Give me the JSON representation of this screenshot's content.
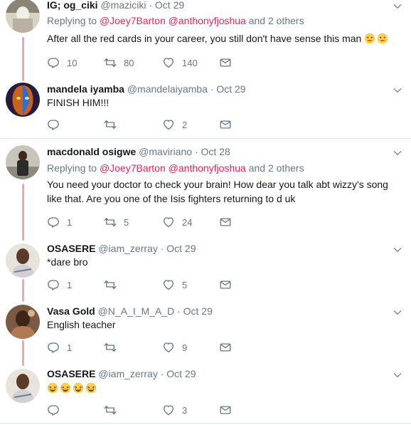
{
  "tweets": [
    {
      "name": "IG; og_ciki",
      "handle": "@maziciki",
      "date": "Oct 29",
      "replying_prefix": "Replying to",
      "mention1": "@Joey7Barton",
      "mention2": "@anthonyfjoshua",
      "replying_suffix": "and 2 others",
      "text": "After all the red cards in your career, you still don't have sense this man",
      "reply_count": "10",
      "retweet_count": "80",
      "like_count": "140"
    },
    {
      "name": "mandela iyamba",
      "handle": "@mandelaiyamba",
      "date": "Oct 29",
      "text": "FINISH HIM!!!",
      "reply_count": "",
      "retweet_count": "",
      "like_count": "2"
    },
    {
      "name": "macdonald osigwe",
      "handle": "@maviriano",
      "date": "Oct 28",
      "replying_prefix": "Replying to",
      "mention1": "@Joey7Barton",
      "mention2": "@anthonyfjoshua",
      "replying_suffix": "and 2 others",
      "text": "You need your doctor to check your brain! How dear you talk abt wizzy's song like that. Are you one of the Isis fighters returning to d uk",
      "reply_count": "1",
      "retweet_count": "5",
      "like_count": "24"
    },
    {
      "name": "OSASERE",
      "handle": "@iam_zerray",
      "date": "Oct 29",
      "text": "*dare bro",
      "reply_count": "1",
      "retweet_count": "",
      "like_count": "5"
    },
    {
      "name": "Vasa Gold",
      "handle": "@N_A_I_M_A_D",
      "date": "Oct 29",
      "text": "English teacher",
      "reply_count": "1",
      "retweet_count": "",
      "like_count": "9"
    },
    {
      "name": "OSASERE",
      "handle": "@iam_zerray",
      "date": "Oct 29",
      "text": "",
      "reply_count": "",
      "retweet_count": "",
      "like_count": "3"
    }
  ],
  "icons": {
    "reply": "reply-icon",
    "retweet": "retweet-icon",
    "like": "heart-icon",
    "dm": "envelope-icon",
    "caret": "chevron-down-icon"
  },
  "colors": {
    "accent": "#e0245e",
    "muted": "#657786",
    "thread_line": "#f4a4ae",
    "separator": "#e1e8ed"
  }
}
